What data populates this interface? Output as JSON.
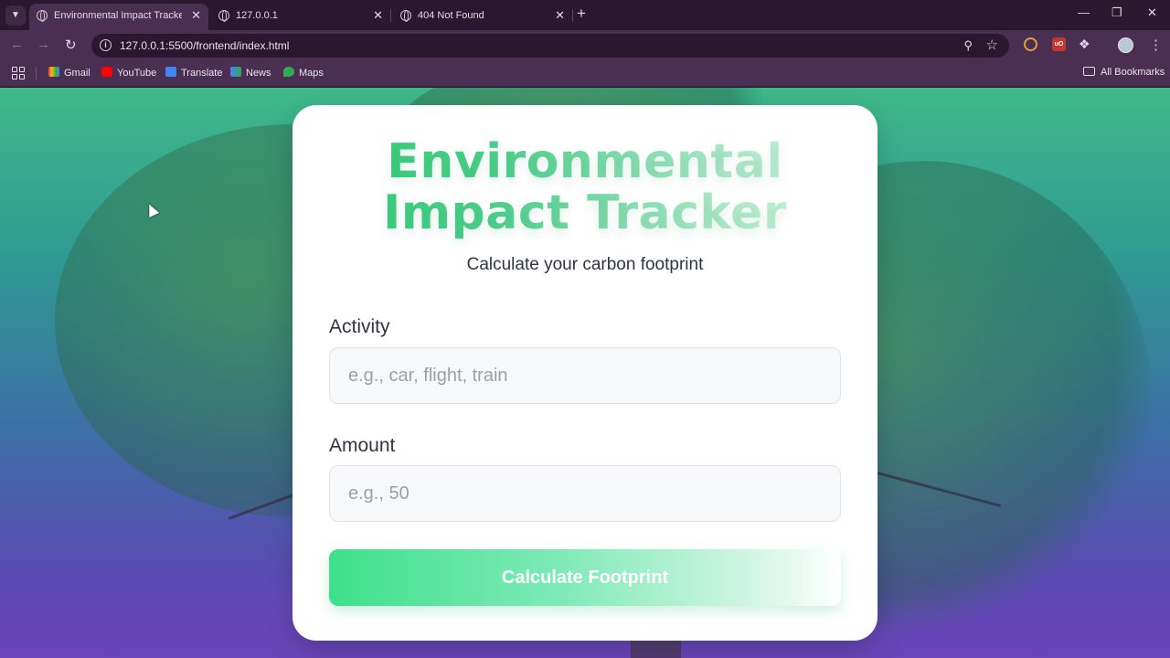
{
  "browser": {
    "tabs": [
      {
        "title": "Environmental Impact Tracker",
        "active": true
      },
      {
        "title": "127.0.0.1",
        "active": false
      },
      {
        "title": "404 Not Found",
        "active": false
      }
    ],
    "new_tab": "+",
    "url": "127.0.0.1:5500/frontend/index.html",
    "bookmarks": [
      "Gmail",
      "YouTube",
      "Translate",
      "News",
      "Maps"
    ],
    "all_bookmarks": "All Bookmarks",
    "icons": {
      "menu": "chevron-down-icon",
      "back": "back-arrow-icon",
      "forward": "forward-arrow-icon",
      "reload": "reload-icon",
      "zoom": "zoom-icon",
      "star": "star-icon",
      "ublock_text": "uO"
    },
    "colors": {
      "chrome_bg": "#4a2f52",
      "tabbar_bg": "#2b1830"
    }
  },
  "page": {
    "title_line1": "Environmental",
    "title_line2": "Impact Tracker",
    "subtitle": "Calculate your carbon footprint",
    "form": {
      "activity_label": "Activity",
      "activity_placeholder": "e.g., car, flight, train",
      "activity_value": "",
      "amount_label": "Amount",
      "amount_placeholder": "e.g., 50",
      "amount_value": "",
      "submit_label": "Calculate Footprint"
    },
    "colors": {
      "accent": "#2ecc71",
      "gradient_top": "#3fb98a",
      "gradient_bottom": "#6a44b8"
    }
  }
}
